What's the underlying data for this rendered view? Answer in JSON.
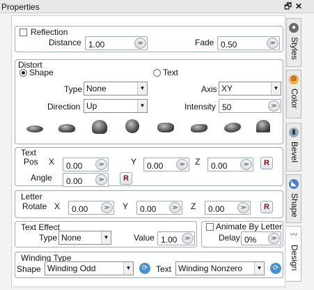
{
  "window": {
    "title": "Properties"
  },
  "reflection": {
    "label": "Reflection",
    "distance_label": "Distance",
    "distance": "1.00",
    "fade_label": "Fade",
    "fade": "0.50"
  },
  "distort": {
    "title": "Distort",
    "shape_label": "Shape",
    "text_label": "Text",
    "type_label": "Type",
    "type": "None",
    "axis_label": "Axis",
    "axis": "XY",
    "direction_label": "Direction",
    "direction": "Up",
    "intensity_label": "Intensity",
    "intensity": "50"
  },
  "text": {
    "title": "Text",
    "pos_label": "Pos",
    "x_label": "X",
    "x": "0.00",
    "y_label": "Y",
    "y": "0.00",
    "z_label": "Z",
    "z": "0.00",
    "angle_label": "Angle",
    "angle": "0.00",
    "reset_label": "R"
  },
  "letter": {
    "title": "Letter",
    "rotate_label": "Rotate",
    "x_label": "X",
    "x": "0.00",
    "y_label": "Y",
    "y": "0.00",
    "z_label": "Z",
    "z": "0.00",
    "reset_label": "R"
  },
  "text_effect": {
    "title": "Text Effect",
    "type_label": "Type",
    "type": "None",
    "value_label": "Value",
    "value": "1.00"
  },
  "animate": {
    "label": "Animate By Letter",
    "delay_label": "Delay",
    "delay": "0%"
  },
  "winding": {
    "title": "Winding Type",
    "shape_label": "Shape",
    "shape": "Winding Odd",
    "text_label": "Text",
    "text": "Winding Nonzero"
  },
  "tabs": [
    {
      "label": "Styles"
    },
    {
      "label": "Color"
    },
    {
      "label": "Bevel"
    },
    {
      "label": "Shape"
    },
    {
      "label": "Design"
    }
  ],
  "icons": {
    "pin": "pin-icon",
    "close": "close-icon"
  },
  "colors": {
    "border": "#9ea8b6",
    "panel": "#ffffff",
    "background": "#f3f3f3"
  }
}
